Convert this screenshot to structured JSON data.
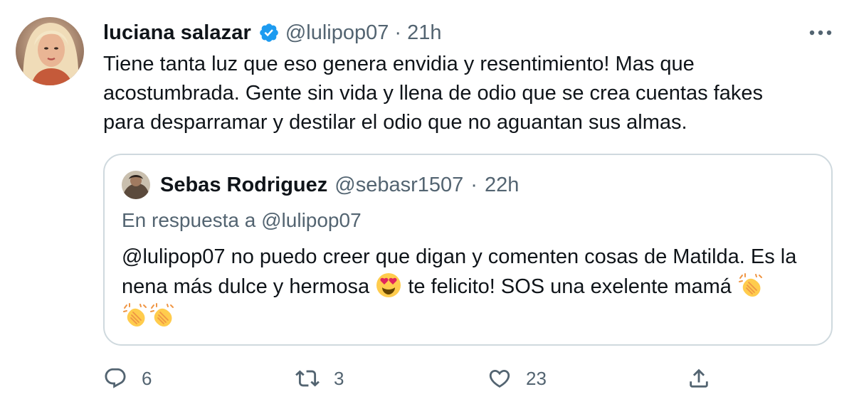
{
  "author": {
    "display_name": "luciana salazar",
    "handle": "@lulipop07",
    "separator": "·",
    "time": "21h",
    "verified_icon": "verified-badge-icon"
  },
  "tweet_text": "Tiene tanta luz que eso genera envidia y resentimiento! Mas que\nacostumbrada. Gente sin vida y llena de odio que se crea cuentas fakes\npara desparramar y destilar el odio que no aguantan sus almas.",
  "quoted_tweet": {
    "display_name": "Sebas Rodriguez",
    "handle": "@sebasr1507",
    "separator": "·",
    "time": "22h",
    "reply_prefix": "En respuesta a",
    "reply_mention": "@lulipop07",
    "text_part1": "@lulipop07 no puedo creer que digan y comenten cosas de Matilda. Es la nena más dulce y hermosa",
    "text_part2": "te felicito! SOS una exelente mamá",
    "emojis": [
      "heart-eyes-emoji",
      "clapping-hands-emoji",
      "clapping-hands-emoji",
      "clapping-hands-emoji"
    ]
  },
  "actions": {
    "reply_count": "6",
    "retweet_count": "3",
    "like_count": "23"
  },
  "colors": {
    "text": "#0f1419",
    "secondary": "#536471",
    "border": "#cfd9de",
    "verified": "#1d9bf0"
  }
}
